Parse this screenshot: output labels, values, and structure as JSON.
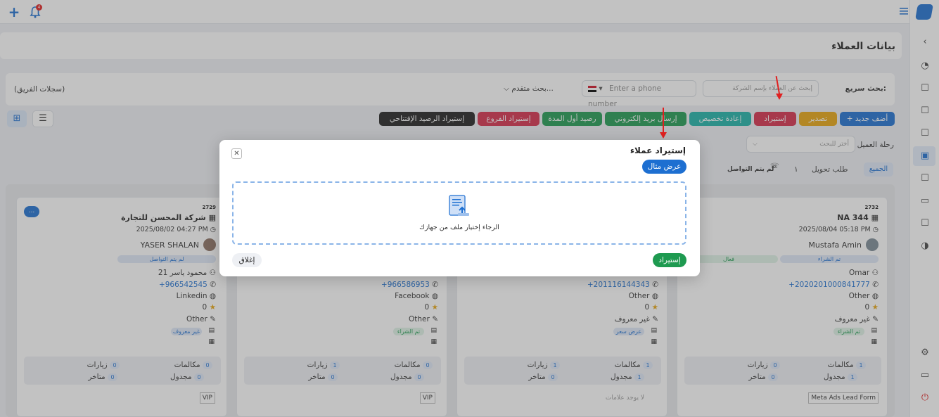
{
  "topbar": {
    "notif_count": "4"
  },
  "header": {
    "title": "بيانات العملاء"
  },
  "search": {
    "quick_label": "بحث سريع:",
    "company_placeholder": "إبحث عن العملاء بإسم الشركة",
    "phone_placeholder": "Enter a phone number",
    "advanced": "بحث متقدم...",
    "team_records": "(سجلات الفريق)"
  },
  "toolbar": {
    "add_new": "+ أضف جديد",
    "export": "تصدير",
    "import": "إستيراد",
    "reassign": "إعادة تخصيص",
    "send_email": "إرسال بريد إلكتروني",
    "opening_balance": "رصيد أول المدة",
    "import_branches": "إستيراد الفروع",
    "import_opening_balance": "إستيراد الرصيد الإفتتاحي"
  },
  "journey": {
    "label": "رحلة العميل",
    "placeholder": "أختر للبحث",
    "tab_all": "الجميع",
    "tab_transfer": "طلب تحويل",
    "tab_one": "١",
    "tab_not_contacted": "لم يتم التواصل"
  },
  "cards": [
    {
      "id": "2732",
      "name": "NA 344",
      "date": "2025/08/04 05:18 PM",
      "owner": "Mustafa Amin",
      "status_left": "فعال",
      "status_right": "تم الشراء",
      "contact": "Omar",
      "phone": "+2020201000841777",
      "source": "Other",
      "rating": "0",
      "field": "غير معروف",
      "badge": "تم الشراء",
      "calls": "1",
      "calls_label": "مكالمات",
      "visits": "0",
      "visits_label": "زيارات",
      "scheduled": "1",
      "scheduled_label": "مجدول",
      "late": "0",
      "late_label": "متاخر",
      "tag": "Meta Ads Lead Form"
    },
    {
      "phone": "+201116144343",
      "source": "Other",
      "rating": "0",
      "field": "غير معروف",
      "badge": "عرض سعر",
      "calls": "1",
      "calls_label": "مكالمات",
      "visits": "1",
      "visits_label": "زيارات",
      "scheduled": "1",
      "scheduled_label": "مجدول",
      "late": "0",
      "late_label": "متاخر",
      "tag": "لا يوجد علامات"
    },
    {
      "phone": "+966586953",
      "source": "Facebook",
      "rating": "0",
      "field": "Other",
      "badge": "تم الشراء",
      "calls": "0",
      "calls_label": "مكالمات",
      "visits": "1",
      "visits_label": "زيارات",
      "scheduled": "0",
      "scheduled_label": "مجدول",
      "late": "0",
      "late_label": "متاخر",
      "tag": "VIP"
    },
    {
      "id": "2729",
      "name": "شركة المحسن للتجارة",
      "date": "2025/08/02 04:27 PM",
      "owner": "YASER SHALAN",
      "status_right": "لم يتم التواصل",
      "contact": "محمود ياسر 21",
      "phone": "+966542545",
      "source": "Linkedin",
      "rating": "0",
      "field": "Other",
      "badge": "غير معروف",
      "calls": "0",
      "calls_label": "مكالمات",
      "visits": "0",
      "visits_label": "زيارات",
      "scheduled": "0",
      "scheduled_label": "مجدول",
      "late": "0",
      "late_label": "متاخر",
      "tag": "VIP",
      "more": "..."
    }
  ],
  "modal": {
    "title": "إستيراد عملاء",
    "example": "عرض مثال",
    "drop_text": "الرجاء إختيار ملف من جهازك",
    "import": "إستيراد",
    "close": "إغلاق"
  },
  "colors": {
    "primary": "#1d6fd1",
    "export": "#e8a50f",
    "import": "#d62d4a",
    "reassign": "#1cb3a8",
    "green": "#1e9a50",
    "black": "#1f1f1f"
  }
}
